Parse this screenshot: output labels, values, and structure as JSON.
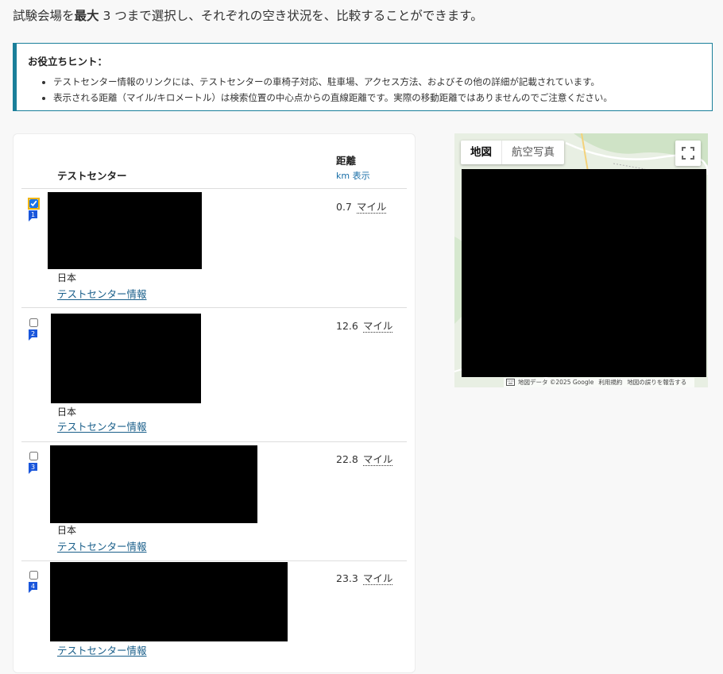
{
  "intro": {
    "part1": "試験会場を",
    "strong1": "最大",
    "part2": " 3 つまで選択し、それぞれの空き状況を、比較することができます。"
  },
  "hint": {
    "title": "お役立ちヒント：",
    "items": [
      "テストセンター情報のリンクには、テストセンターの車椅子対応、駐車場、アクセス方法、およびその他の詳細が記載されています。",
      "表示される距離（マイル/キロメートル）は検索位置の中心点からの直線距離です。実際の移動距離ではありませんのでご注意ください。"
    ]
  },
  "table": {
    "col_center": "テストセンター",
    "col_distance": "距離",
    "unit_toggle": "km 表示",
    "rows": [
      {
        "number": "1",
        "country": "日本",
        "link": "テストセンター情報",
        "distance": "0.7",
        "unit": "マイル",
        "selected": true
      },
      {
        "number": "2",
        "country": "日本",
        "link": "テストセンター情報",
        "distance": "12.6",
        "unit": "マイル",
        "selected": false
      },
      {
        "number": "3",
        "country": "日本",
        "link": "テストセンター情報",
        "distance": "22.8",
        "unit": "マイル",
        "selected": false
      },
      {
        "number": "4",
        "country": "",
        "link": "テストセンター情報",
        "distance": "23.3",
        "unit": "マイル",
        "selected": false
      }
    ]
  },
  "map": {
    "tab_map": "地図",
    "tab_satellite": "航空写真",
    "footer_data": "地図データ ©2025 Google",
    "footer_terms": "利用規約",
    "footer_report": "地図の誤りを報告する",
    "colors": {
      "marker": "#1a56db",
      "accent": "#1a7f9a"
    }
  }
}
